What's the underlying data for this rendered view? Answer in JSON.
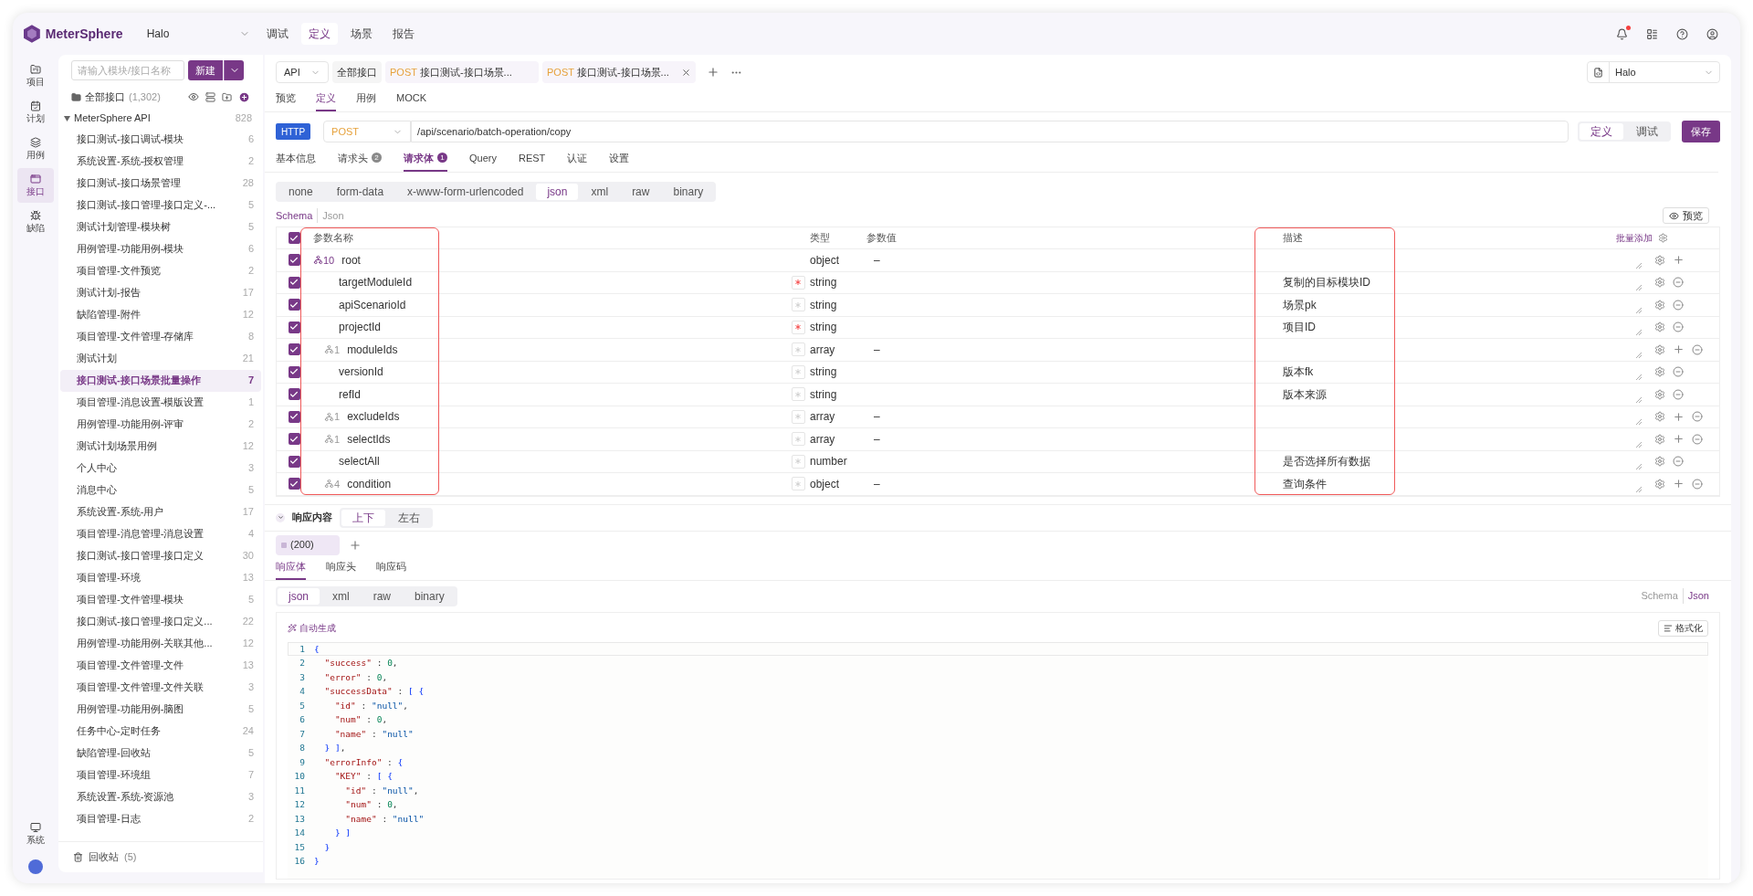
{
  "app": {
    "name": "MeterSphere",
    "project": "Halo"
  },
  "top_nav": [
    {
      "label": "调试",
      "selected": false
    },
    {
      "label": "定义",
      "selected": true
    },
    {
      "label": "场景",
      "selected": false
    },
    {
      "label": "报告",
      "selected": false
    }
  ],
  "notifications": {
    "unread": true
  },
  "rail": {
    "items": [
      {
        "label": "项目",
        "selected": false
      },
      {
        "label": "计划",
        "selected": false
      },
      {
        "label": "用例",
        "selected": false
      },
      {
        "label": "接口",
        "selected": true
      },
      {
        "label": "缺陷",
        "selected": false
      }
    ],
    "bottom": "系统"
  },
  "tree": {
    "search_placeholder": "请输入模块/接口名称",
    "new_button": "新建",
    "all_label": "全部接口",
    "all_count": "(1,302)",
    "root": {
      "label": "MeterSphere API",
      "count": "828",
      "expanded": true,
      "children": [
        {
          "label": "接口测试-接口调试-模块",
          "count": "6",
          "selected": false
        },
        {
          "label": "系统设置-系统-授权管理",
          "count": "2",
          "selected": false
        },
        {
          "label": "接口测试-接口场景管理",
          "count": "28",
          "selected": false
        },
        {
          "label": "接口测试-接口管理-接口定义-...",
          "count": "5",
          "selected": false
        },
        {
          "label": "测试计划管理-模块树",
          "count": "5",
          "selected": false
        },
        {
          "label": "用例管理-功能用例-模块",
          "count": "6",
          "selected": false
        },
        {
          "label": "项目管理-文件预览",
          "count": "2",
          "selected": false
        },
        {
          "label": "测试计划-报告",
          "count": "17",
          "selected": false
        },
        {
          "label": "缺陷管理-附件",
          "count": "12",
          "selected": false
        },
        {
          "label": "项目管理-文件管理-存储库",
          "count": "8",
          "selected": false
        },
        {
          "label": "测试计划",
          "count": "21",
          "selected": false
        },
        {
          "label": "接口测试-接口场景批量操作",
          "count": "7",
          "selected": true
        },
        {
          "label": "项目管理-消息设置-模版设置",
          "count": "1",
          "selected": false
        },
        {
          "label": "用例管理-功能用例-评审",
          "count": "2",
          "selected": false
        },
        {
          "label": "测试计划场景用例",
          "count": "12",
          "selected": false
        },
        {
          "label": "个人中心",
          "count": "3",
          "selected": false
        },
        {
          "label": "消息中心",
          "count": "5",
          "selected": false
        },
        {
          "label": "系统设置-系统-用户",
          "count": "17",
          "selected": false
        },
        {
          "label": "项目管理-消息管理-消息设置",
          "count": "4",
          "selected": false
        },
        {
          "label": "接口测试-接口管理-接口定义",
          "count": "30",
          "selected": false
        },
        {
          "label": "项目管理-环境",
          "count": "13",
          "selected": false
        },
        {
          "label": "项目管理-文件管理-模块",
          "count": "5",
          "selected": false
        },
        {
          "label": "接口测试-接口管理-接口定义...",
          "count": "22",
          "selected": false
        },
        {
          "label": "用例管理-功能用例-关联其他...",
          "count": "12",
          "selected": false
        },
        {
          "label": "项目管理-文件管理-文件",
          "count": "13",
          "selected": false
        },
        {
          "label": "项目管理-文件管理-文件关联",
          "count": "3",
          "selected": false
        },
        {
          "label": "用例管理-功能用例-脑图",
          "count": "5",
          "selected": false
        },
        {
          "label": "任务中心-定时任务",
          "count": "24",
          "selected": false
        },
        {
          "label": "缺陷管理-回收站",
          "count": "5",
          "selected": false
        },
        {
          "label": "项目管理-环境组",
          "count": "7",
          "selected": false
        },
        {
          "label": "系统设置-系统-资源池",
          "count": "3",
          "selected": false
        },
        {
          "label": "项目管理-日志",
          "count": "2",
          "selected": false
        }
      ]
    },
    "recycle_label": "回收站",
    "recycle_count": "(5)"
  },
  "tabs": {
    "type_select": "API",
    "items": [
      {
        "kind": "plain",
        "label": "全部接口",
        "closable": false
      },
      {
        "kind": "request",
        "method": "POST",
        "label": "接口测试-接口场景...",
        "closable": false
      },
      {
        "kind": "request",
        "method": "POST",
        "label": "接口测试-接口场景...",
        "closable": true
      }
    ],
    "environment": "Halo"
  },
  "sub_tabs": [
    {
      "label": "预览",
      "selected": false
    },
    {
      "label": "定义",
      "selected": true
    },
    {
      "label": "用例",
      "selected": false
    },
    {
      "label": "MOCK",
      "selected": false
    }
  ],
  "request": {
    "protocol": "HTTP",
    "method": "POST",
    "url": "/api/scenario/batch-operation/copy",
    "mode": [
      {
        "label": "定义",
        "selected": true
      },
      {
        "label": "调试",
        "selected": false
      }
    ],
    "save": "保存"
  },
  "request_tabs": [
    {
      "label": "基本信息",
      "selected": false
    },
    {
      "label": "请求头",
      "badge": "2",
      "selected": false
    },
    {
      "label": "请求体",
      "badge": "1",
      "selected": true
    },
    {
      "label": "Query",
      "selected": false
    },
    {
      "label": "REST",
      "selected": false
    },
    {
      "label": "认证",
      "selected": false
    },
    {
      "label": "设置",
      "selected": false
    }
  ],
  "body_types": [
    {
      "label": "none",
      "selected": false
    },
    {
      "label": "form-data",
      "selected": false
    },
    {
      "label": "x-www-form-urlencoded",
      "selected": false
    },
    {
      "label": "json",
      "selected": true
    },
    {
      "label": "xml",
      "selected": false
    },
    {
      "label": "raw",
      "selected": false
    },
    {
      "label": "binary",
      "selected": false
    }
  ],
  "schema_toggle": [
    {
      "label": "Schema",
      "selected": true
    },
    {
      "label": "Json",
      "selected": false
    }
  ],
  "preview_button": "预览",
  "params": {
    "all_checked": true,
    "columns": [
      {
        "label": "参数名称",
        "highlighted": true
      },
      {
        "label": "类型"
      },
      {
        "label": "参数值"
      },
      {
        "label": "描述",
        "highlighted": true
      }
    ],
    "batch_add": "批量添加",
    "rows": [
      {
        "checked": true,
        "name": "root",
        "child_count": "10",
        "expanded": true,
        "type": "object",
        "value": "–",
        "children": [
          {
            "checked": true,
            "name": "targetModuleId",
            "required": true,
            "type": "string",
            "description": "复制的目标模块ID"
          },
          {
            "checked": true,
            "name": "apiScenarioId",
            "required": false,
            "type": "string",
            "description": "场景pk"
          },
          {
            "checked": true,
            "name": "projectId",
            "required": true,
            "type": "string",
            "description": "项目ID"
          },
          {
            "checked": true,
            "name": "moduleIds",
            "child_count": "1",
            "expanded": false,
            "required": false,
            "type": "array",
            "value": "–"
          },
          {
            "checked": true,
            "name": "versionId",
            "required": false,
            "type": "string",
            "description": "版本fk"
          },
          {
            "checked": true,
            "name": "refId",
            "required": false,
            "type": "string",
            "description": "版本来源"
          },
          {
            "checked": true,
            "name": "excludeIds",
            "child_count": "1",
            "expanded": false,
            "required": false,
            "type": "array",
            "value": "–"
          },
          {
            "checked": true,
            "name": "selectIds",
            "child_count": "1",
            "expanded": false,
            "required": false,
            "type": "array",
            "value": "–"
          },
          {
            "checked": true,
            "name": "selectAll",
            "required": false,
            "type": "number",
            "description": "是否选择所有数据"
          },
          {
            "checked": true,
            "name": "condition",
            "child_count": "4",
            "expanded": false,
            "required": false,
            "type": "object",
            "value": "–",
            "description": "查询条件"
          }
        ]
      }
    ]
  },
  "response": {
    "title": "响应内容",
    "expanded": true,
    "layout": [
      {
        "label": "上下",
        "selected": true
      },
      {
        "label": "左右",
        "selected": false
      }
    ],
    "codes": [
      {
        "label": "(200)",
        "selected": true
      }
    ],
    "tabs": [
      {
        "label": "响应体",
        "selected": true
      },
      {
        "label": "响应头",
        "selected": false
      },
      {
        "label": "响应码",
        "selected": false
      }
    ],
    "body_types": [
      {
        "label": "json",
        "selected": true
      },
      {
        "label": "xml",
        "selected": false
      },
      {
        "label": "raw",
        "selected": false
      },
      {
        "label": "binary",
        "selected": false
      }
    ],
    "view_toggle": [
      {
        "label": "Schema",
        "selected": false
      },
      {
        "label": "Json",
        "selected": true
      }
    ],
    "auto_generate": "自动生成",
    "format_button": "格式化",
    "code": [
      {
        "no": "1",
        "text": "{"
      },
      {
        "no": "2",
        "text": "  \"success\" : 0,"
      },
      {
        "no": "3",
        "text": "  \"error\" : 0,"
      },
      {
        "no": "4",
        "text": "  \"successData\" : [ {"
      },
      {
        "no": "5",
        "text": "    \"id\" : \"null\","
      },
      {
        "no": "6",
        "text": "    \"num\" : 0,"
      },
      {
        "no": "7",
        "text": "    \"name\" : \"null\""
      },
      {
        "no": "8",
        "text": "  } ],"
      },
      {
        "no": "9",
        "text": "  \"errorInfo\" : {"
      },
      {
        "no": "10",
        "text": "    \"KEY\" : [ {"
      },
      {
        "no": "11",
        "text": "      \"id\" : \"null\","
      },
      {
        "no": "12",
        "text": "      \"num\" : 0,"
      },
      {
        "no": "13",
        "text": "      \"name\" : \"null\""
      },
      {
        "no": "14",
        "text": "    } ]"
      },
      {
        "no": "15",
        "text": "  }"
      },
      {
        "no": "16",
        "text": "}"
      }
    ]
  }
}
